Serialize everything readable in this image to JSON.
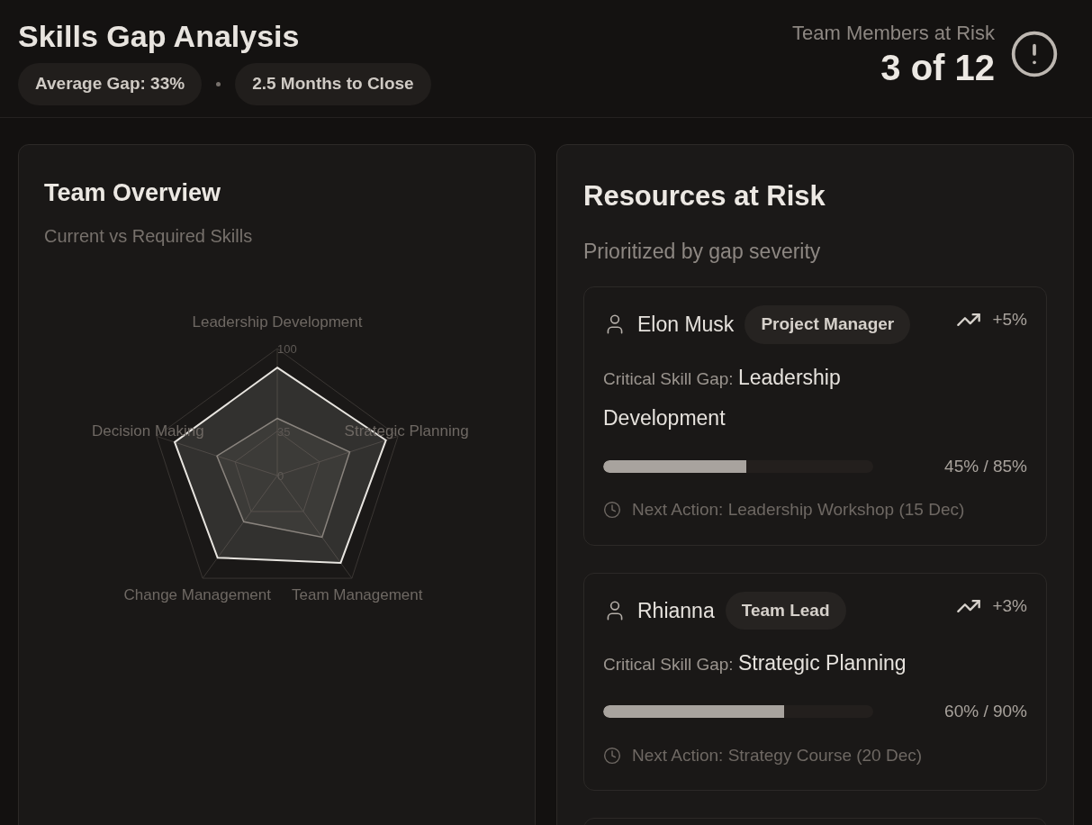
{
  "header": {
    "title": "Skills Gap Analysis",
    "pills": [
      "Average Gap: 33%",
      "2.5 Months to Close"
    ],
    "risk_label": "Team Members at Risk",
    "risk_value": "3 of 12"
  },
  "team_overview": {
    "title": "Team Overview",
    "subtitle": "Current vs Required Skills",
    "chart_data": {
      "type": "radar",
      "categories": [
        "Leadership Development",
        "Strategic Planning",
        "Team Management",
        "Change Management",
        "Decision Making"
      ],
      "ylim": [
        0,
        100
      ],
      "yticks": [
        0,
        35,
        100
      ],
      "series": [
        {
          "color": "#e8e5e0",
          "values": [
            85,
            90,
            85,
            80,
            85
          ]
        },
        {
          "color": "#8a847e",
          "values": [
            45,
            60,
            60,
            45,
            50
          ]
        }
      ]
    }
  },
  "resources": {
    "title": "Resources at Risk",
    "subtitle": "Prioritized by gap severity",
    "items": [
      {
        "name": "Elon Musk",
        "role": "Project Manager",
        "trend": "+5%",
        "gap_label": "Critical Skill Gap:",
        "gap_skill": "Leadership Development",
        "level": 0.53,
        "reading": "45% / 85%",
        "next_action": "Next Action: Leadership Workshop (15 Dec)"
      },
      {
        "name": "Rhianna",
        "role": "Team Lead",
        "trend": "+3%",
        "gap_label": "Critical Skill Gap:",
        "gap_skill": "Strategic Planning",
        "level": 0.67,
        "reading": "60% / 90%",
        "next_action": "Next Action: Strategy Course (20 Dec)"
      }
    ]
  }
}
